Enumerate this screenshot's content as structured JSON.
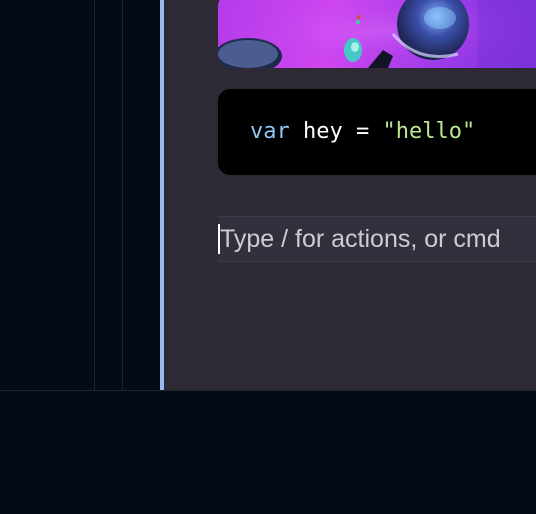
{
  "colors": {
    "panel_bg": "#040b14",
    "editor_bg": "#2d2935",
    "accent": "#9bb9ee",
    "code_bg": "#000000",
    "keyword": "#8fc4f5",
    "string": "#bce894"
  },
  "editor": {
    "image_block": {
      "icon": "abstract-3d-image"
    },
    "code_block": {
      "keyword": "var",
      "identifier": "hey",
      "operator": "=",
      "string": "\"hello\""
    },
    "input": {
      "placeholder": "Type / for actions, or cmd"
    }
  }
}
